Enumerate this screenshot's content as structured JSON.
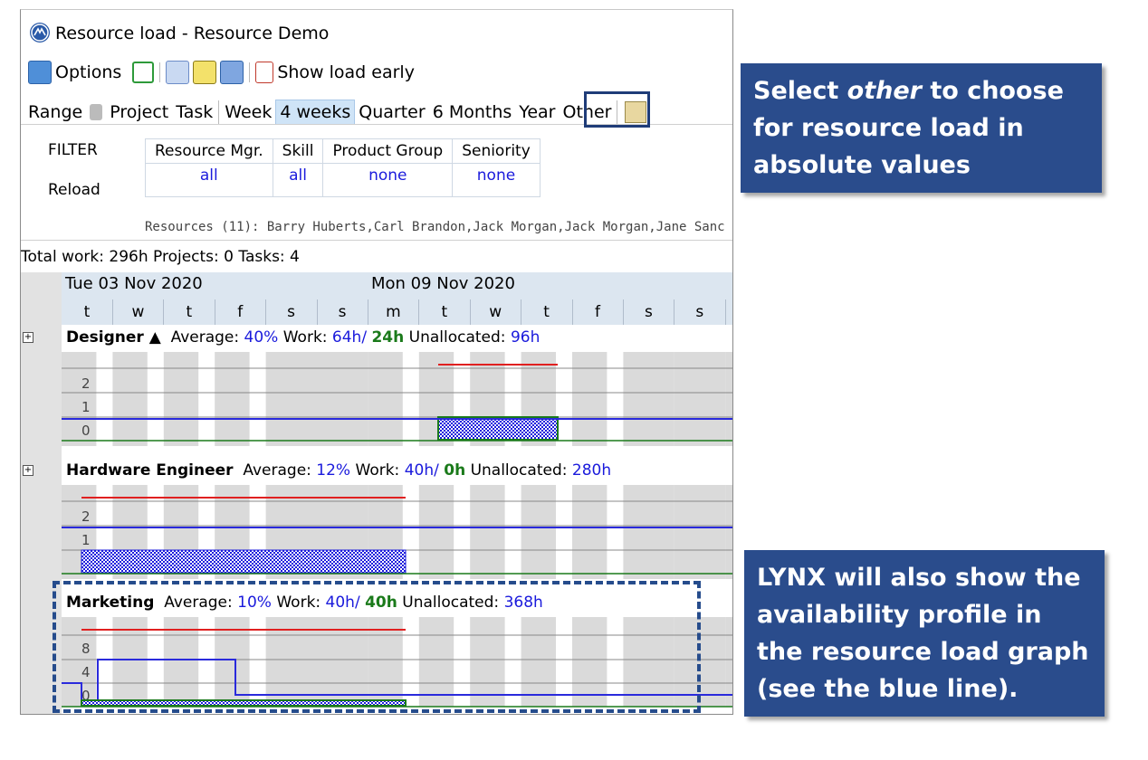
{
  "window": {
    "title": "Resource load - Resource Demo"
  },
  "toolbar": {
    "options_label": "Options",
    "show_load_early_label": "Show load early"
  },
  "range_bar": {
    "items": [
      "Range",
      "Project",
      "Task",
      "Week",
      "4 weeks",
      "Quarter",
      "6 Months",
      "Year",
      "Other"
    ],
    "selected": "4 weeks"
  },
  "filter": {
    "filter_label": "FILTER",
    "reload_label": "Reload",
    "columns": [
      {
        "header": "Resource Mgr.",
        "value": "all"
      },
      {
        "header": "Skill",
        "value": "all"
      },
      {
        "header": "Product Group",
        "value": "none"
      },
      {
        "header": "Seniority",
        "value": "none"
      }
    ]
  },
  "resources_line": "Resources (11): Barry Huberts,Carl Brandon,Jack Morgan,Jack Morgan,Jane Sanc",
  "stats": {
    "text": "Total work: 296h  Projects: 0  Tasks: 4"
  },
  "gantt": {
    "weeks": [
      "Tue 03 Nov 2020",
      "Mon 09 Nov 2020"
    ],
    "days": [
      "t",
      "w",
      "t",
      "f",
      "s",
      "s",
      "m",
      "t",
      "w",
      "t",
      "f",
      "s",
      "s"
    ],
    "groups": [
      {
        "name": "Designer ▲",
        "avg_label": "Average:",
        "avg": "40%",
        "work_label": "Work:",
        "work": "64h/",
        "work_alloc": "24h",
        "unalloc_label": "Unallocated:",
        "unalloc": "96h",
        "y_labels": [
          "2",
          "1",
          "0"
        ]
      },
      {
        "name": "Hardware Engineer",
        "avg_label": "Average:",
        "avg": "12%",
        "work_label": "Work:",
        "work": "40h/",
        "work_alloc": "0h",
        "unalloc_label": "Unallocated:",
        "unalloc": "280h",
        "y_labels": [
          "2",
          "1"
        ]
      },
      {
        "name": "Marketing",
        "avg_label": "Average:",
        "avg": "10%",
        "work_label": "Work:",
        "work": "40h/",
        "work_alloc": "40h",
        "unalloc_label": "Unallocated:",
        "unalloc": "368h",
        "y_labels": [
          "8",
          "4",
          "0"
        ]
      }
    ]
  },
  "callouts": {
    "top": {
      "pre": "Select ",
      "em": "other",
      "post": " to choose for resource load in absolute values"
    },
    "bottom": "LYNX will also show the availability profile in the resource load graph (see the blue line)."
  },
  "colors": {
    "callout_bg": "#2a4c8c",
    "link_blue": "#1a1adc",
    "alloc_green": "#1a7a1a",
    "selected_bg": "#cfe4f7"
  }
}
